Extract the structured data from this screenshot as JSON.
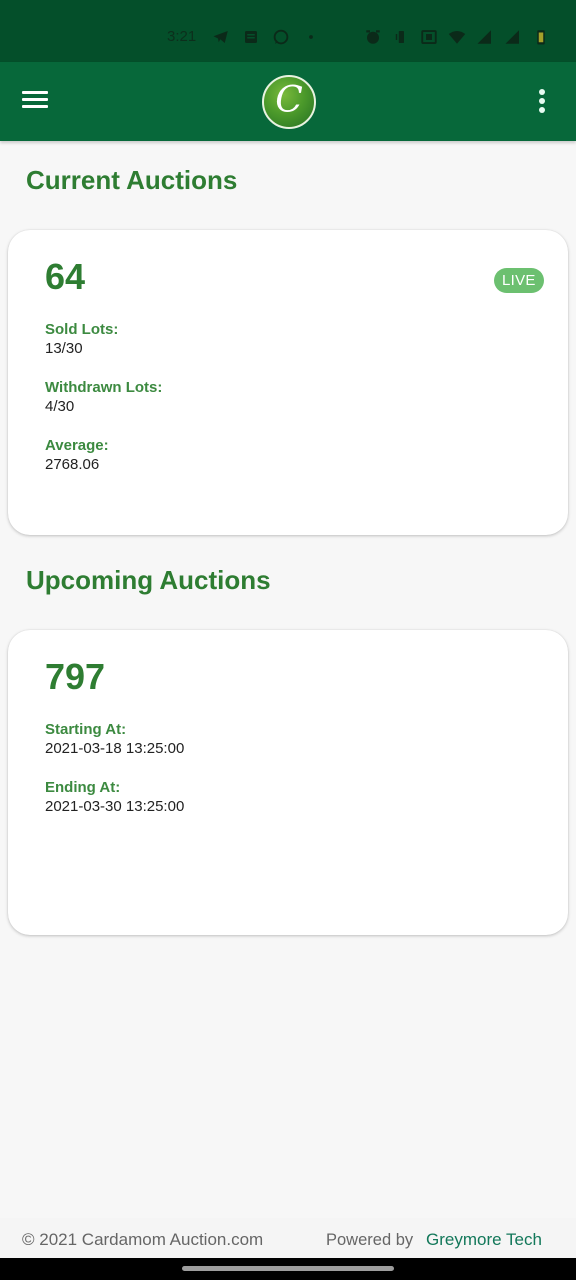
{
  "status_bar": {
    "time": "3:21",
    "left_icons": [
      "telegram-icon",
      "news-icon",
      "whatsapp-icon",
      "dot-icon"
    ],
    "right_icons": [
      "alarm-icon",
      "vibrate-icon",
      "nfc-icon",
      "wifi-icon",
      "signal-icon",
      "signal-icon",
      "battery-icon"
    ]
  },
  "app_bar": {
    "menu_icon": "hamburger-menu-icon",
    "logo_letter": "C",
    "overflow_icon": "more-vert-icon"
  },
  "current_auctions": {
    "title": "Current Auctions",
    "card": {
      "number": "64",
      "status_badge": "LIVE",
      "fields": [
        {
          "label": "Sold Lots:",
          "value": "13/30"
        },
        {
          "label": "Withdrawn Lots:",
          "value": "4/30"
        },
        {
          "label": "Average:",
          "value": "2768.06"
        }
      ]
    }
  },
  "upcoming_auctions": {
    "title": "Upcoming Auctions",
    "card": {
      "number": "797",
      "fields": [
        {
          "label": "Starting At:",
          "value": "2021-03-18 13:25:00"
        },
        {
          "label": "Ending At:",
          "value": "2021-03-30 13:25:00"
        }
      ]
    }
  },
  "footer": {
    "copyright": "© 2021 Cardamom Auction.com",
    "powered_by": "Powered by",
    "vendor": "Greymore Tech"
  },
  "colors": {
    "status_bar": "#044f2a",
    "app_bar": "#07683a",
    "accent_green": "#2e7d32",
    "live_badge": "#6cc070",
    "vendor_link": "#13785a"
  }
}
